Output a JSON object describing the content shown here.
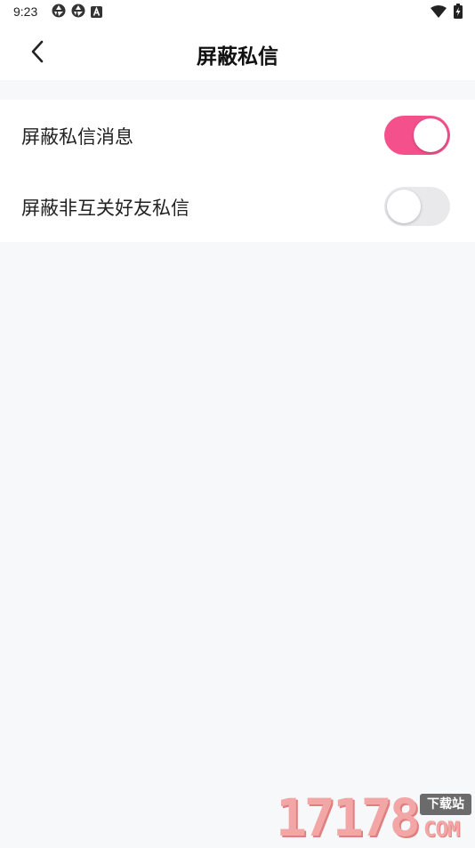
{
  "status_bar": {
    "time": "9:23",
    "icons_left": [
      "aperture-icon",
      "aperture-icon",
      "font-a-icon"
    ],
    "icons_right": [
      "wifi-icon",
      "battery-charging-icon"
    ]
  },
  "nav": {
    "back_icon": "chevron-left-icon",
    "title": "屏蔽私信"
  },
  "settings": [
    {
      "label": "屏蔽私信消息",
      "enabled": true
    },
    {
      "label": "屏蔽非互关好友私信",
      "enabled": false
    }
  ],
  "colors": {
    "accent": "#f4518c",
    "toggle_off": "#e9e9ec",
    "background": "#f7f8fa"
  },
  "watermark": {
    "digits": "17178",
    "badge": "下载站",
    "suffix": "COM"
  }
}
